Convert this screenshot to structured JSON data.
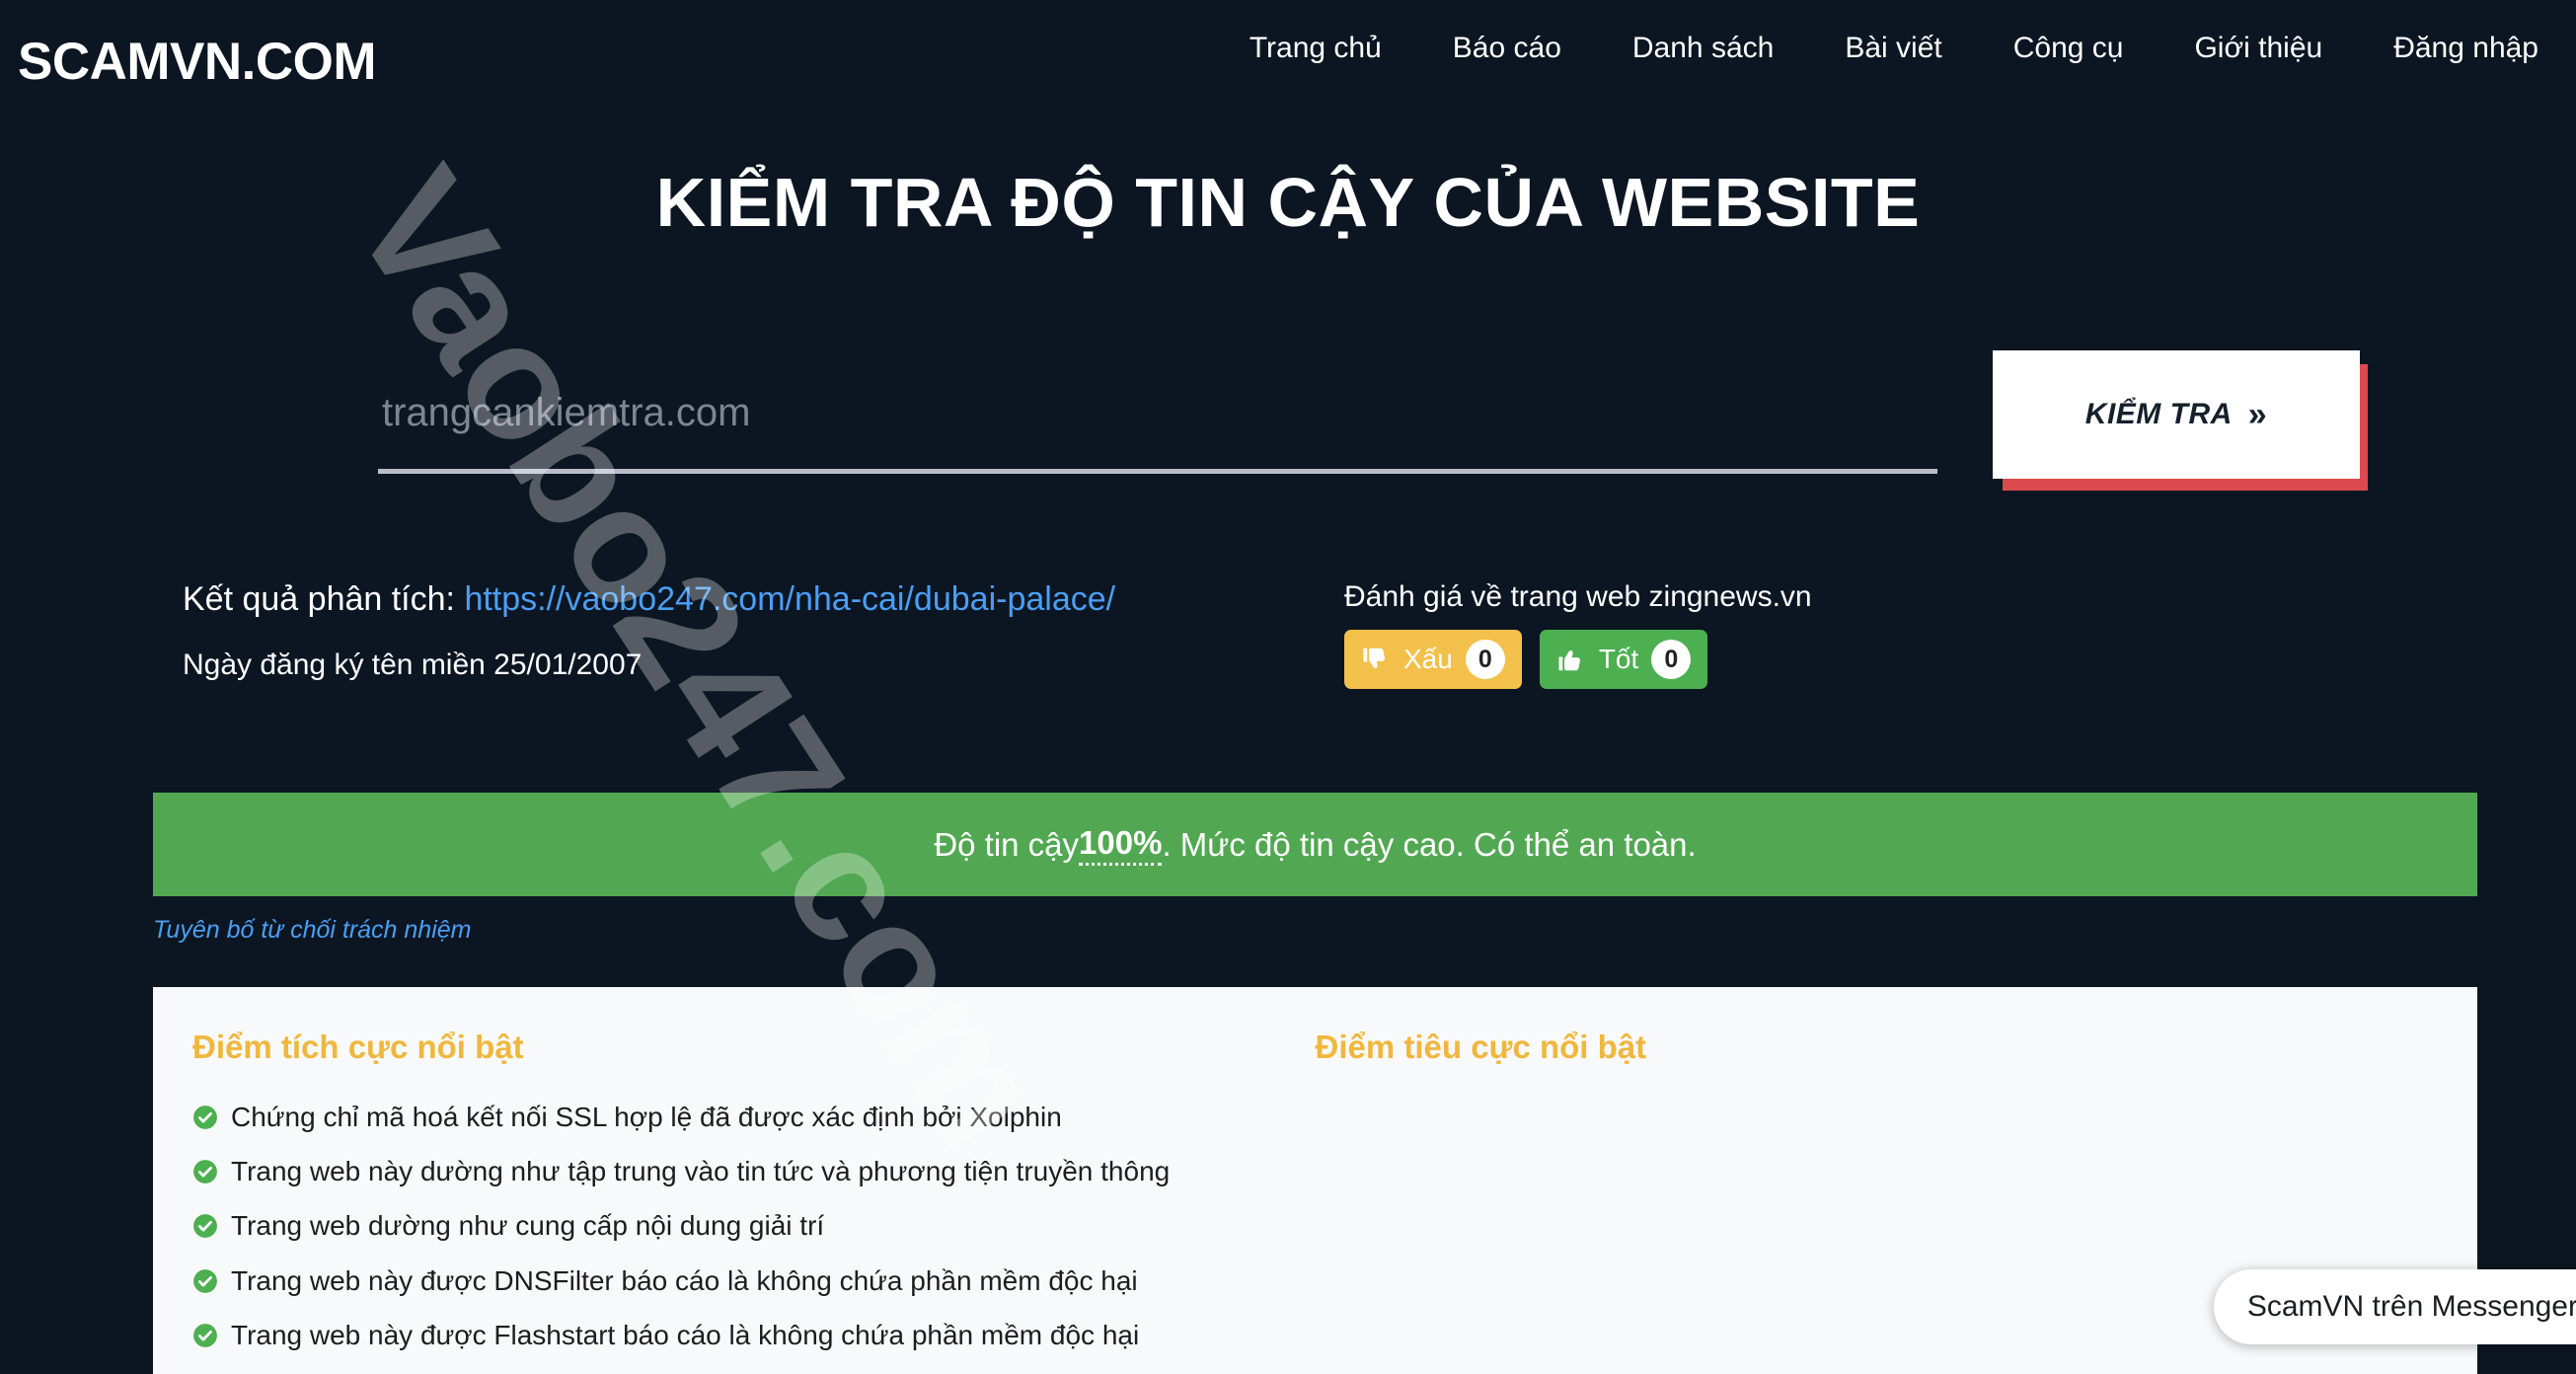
{
  "header": {
    "brand": "SCAMVN.COM",
    "nav": [
      {
        "label": "Trang chủ"
      },
      {
        "label": "Báo cáo"
      },
      {
        "label": "Danh sách"
      },
      {
        "label": "Bài viết"
      },
      {
        "label": "Công cụ"
      },
      {
        "label": "Giới thiệu"
      },
      {
        "label": "Đăng nhập"
      }
    ]
  },
  "hero": {
    "title": "KIỂM TRA ĐỘ TIN CẬY CỦA WEBSITE"
  },
  "search": {
    "placeholder": "trangcankiemtra.com",
    "value": "",
    "button_label": "KIỂM TRA",
    "button_chevron": "»"
  },
  "result": {
    "label": "Kết quả phân tích:",
    "url": "https://vaobo247.com/nha-cai/dubai-palace/",
    "domain_date": "Ngày đăng ký tên miền 25/01/2007"
  },
  "rating": {
    "title": "Đánh giá về trang web zingnews.vn",
    "bad": {
      "label": "Xấu",
      "count": "0",
      "icon": "thumbs-down-icon",
      "color": "#f3c04b"
    },
    "good": {
      "label": "Tốt",
      "count": "0",
      "icon": "thumbs-up-icon",
      "color": "#4caf50"
    }
  },
  "trust": {
    "prefix": "Độ tin cậy ",
    "percent": "100%",
    "suffix": ". Mức độ tin cậy cao. Có thể an toàn.",
    "color": "#52a852"
  },
  "disclaimer": {
    "label": "Tuyên bố từ chối trách nhiệm"
  },
  "positives": {
    "heading": "Điểm tích cực nổi bật",
    "items": [
      "Chứng chỉ mã hoá kết nối SSL hợp lệ đã được xác định bởi Xolphin",
      "Trang web này dường như tập trung vào tin tức và phương tiện truyền thông",
      "Trang web dường như cung cấp nội dung giải trí",
      "Trang web này được DNSFilter báo cáo là không chứa phần mềm độc hại",
      "Trang web này được Flashstart báo cáo là không chứa phần mềm độc hại"
    ]
  },
  "negatives": {
    "heading": "Điểm tiêu cực nổi bật",
    "items": []
  },
  "watermark": {
    "text": "Vaobo247.com"
  },
  "messenger": {
    "label": "ScamVN trên Messenger"
  },
  "colors": {
    "background": "#0c1622",
    "card": "#f8f9fa",
    "accent_yellow": "#f0b73e",
    "accent_blue": "#4a9ff5",
    "accent_red": "#dc4a4f",
    "trust_green": "#52a852"
  }
}
